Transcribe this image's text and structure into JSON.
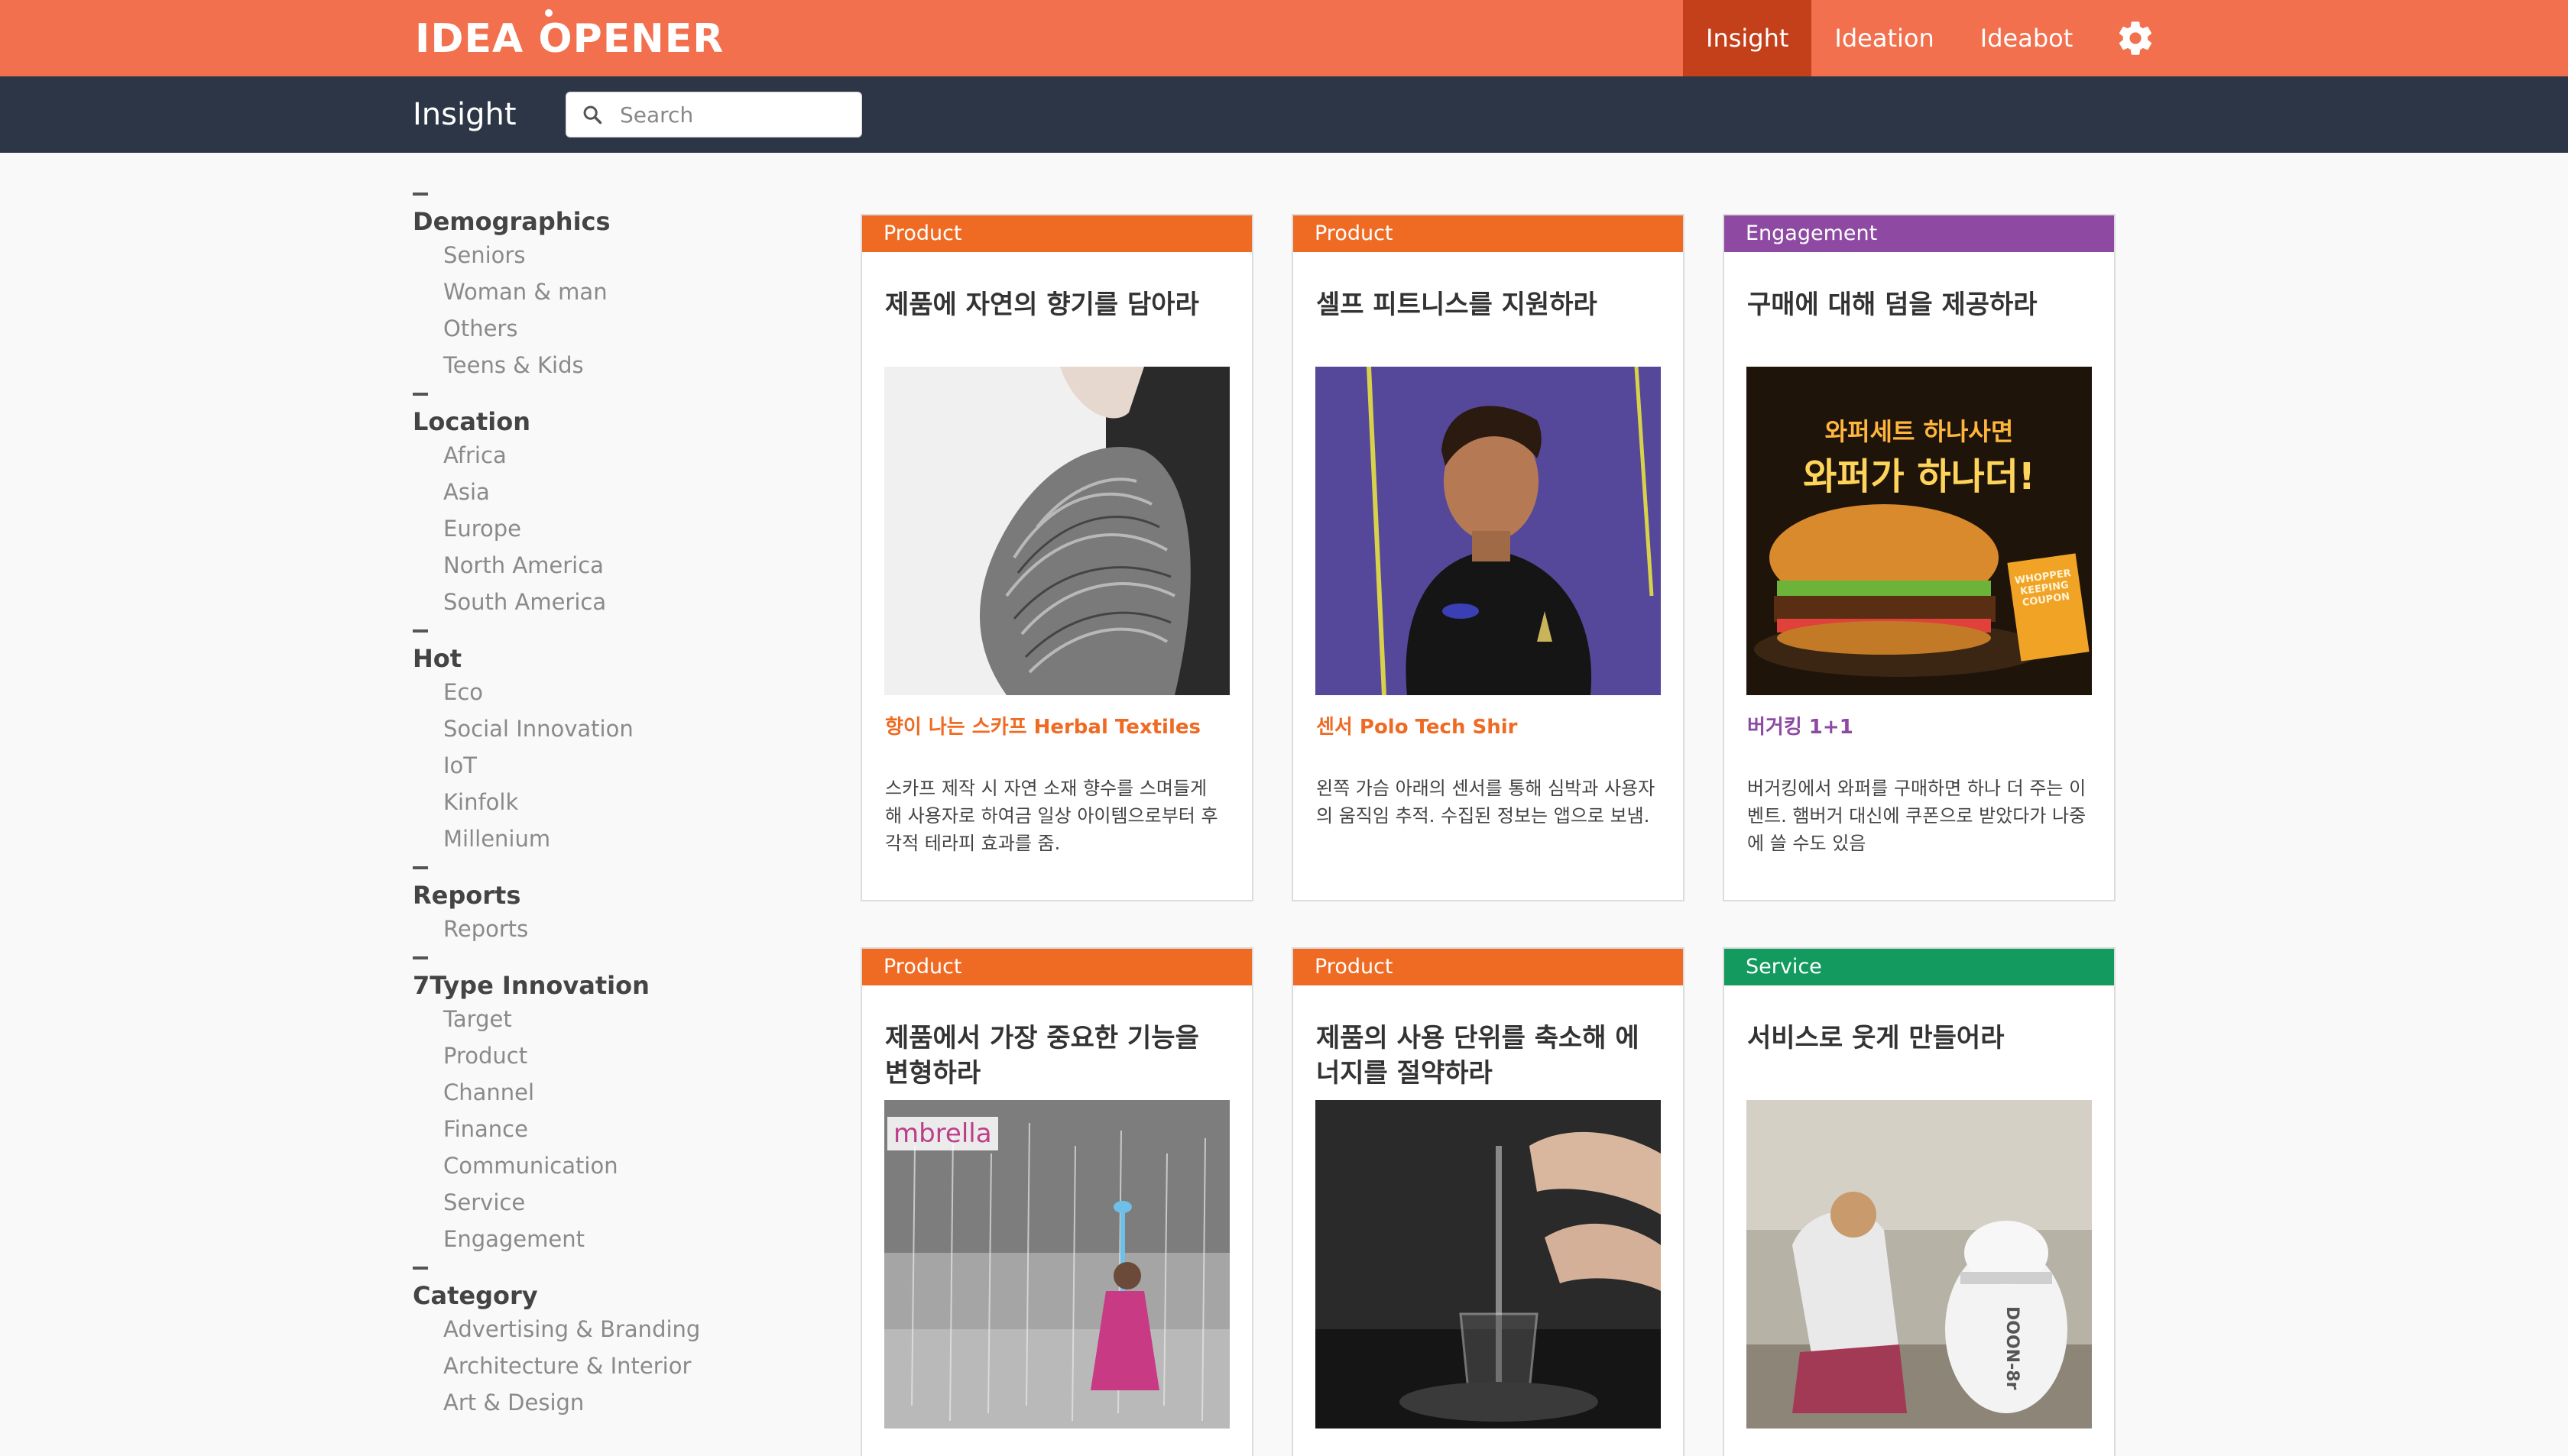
{
  "header": {
    "logo": "IDEA OPENER",
    "nav": [
      {
        "label": "Insight",
        "active": true
      },
      {
        "label": "Ideation",
        "active": false
      },
      {
        "label": "Ideabot",
        "active": false
      }
    ],
    "settings_icon": "gear-icon"
  },
  "subheader": {
    "title": "Insight",
    "search_placeholder": "Search",
    "search_value": ""
  },
  "sidebar": {
    "groups": [
      {
        "heading": "Demographics",
        "items": [
          "Seniors",
          "Woman & man",
          "Others",
          "Teens & Kids"
        ]
      },
      {
        "heading": "Location",
        "items": [
          "Africa",
          "Asia",
          "Europe",
          "North America",
          "South America"
        ]
      },
      {
        "heading": "Hot",
        "items": [
          "Eco",
          "Social Innovation",
          "IoT",
          "Kinfolk",
          "Millenium"
        ]
      },
      {
        "heading": "Reports",
        "items": [
          "Reports"
        ]
      },
      {
        "heading": "7Type Innovation",
        "items": [
          "Target",
          "Product",
          "Channel",
          "Finance",
          "Communication",
          "Service",
          "Engagement"
        ]
      },
      {
        "heading": "Category",
        "items": [
          "Advertising & Branding",
          "Architecture & Interior",
          "Art & Design"
        ]
      }
    ]
  },
  "colors": {
    "brand": "#f2704d",
    "nav_active": "#c4401b",
    "subbar": "#2d3647",
    "product": "#ef6b24",
    "engagement": "#8e4aa3",
    "service": "#129a5f"
  },
  "cards": [
    {
      "tag": "Product",
      "tag_color": "#ef6b24",
      "title": "제품에 자연의 향기를 담아라",
      "subtitle": "향이 나는 스카프 Herbal Textiles",
      "subtitle_color": "#ef6b24",
      "description": "스카프 제작 시 자연 소재 향수를 스며들게 해 사용자로 하여금 일상 아이템으로부터 후각적 테라피 효과를 줌.",
      "image": "scarf-photo"
    },
    {
      "tag": "Product",
      "tag_color": "#ef6b24",
      "title": "셀프 피트니스를 지원하라",
      "subtitle": "센서 Polo Tech Shir",
      "subtitle_color": "#ef6b24",
      "description": "왼쪽 가슴 아래의 센서를 통해 심박과 사용자의 움직임 추적. 수집된 정보는 앱으로 보냄.",
      "image": "tennis-player-photo"
    },
    {
      "tag": "Engagement",
      "tag_color": "#8e4aa3",
      "title": "구매에 대해 덤을 제공하라",
      "subtitle": "버거킹 1+1",
      "subtitle_color": "#8e4aa3",
      "description": "버거킹에서 와퍼를 구매하면 하나 더 주는 이벤트. 햄버거 대신에 쿠폰으로 받았다가 나중에 쓸 수도 있음",
      "image": "burger-ad",
      "image_text": [
        "와퍼세트 하나사면",
        "와퍼가 하나더!"
      ],
      "coupon_text": [
        "WHOPPER",
        "KEEPING",
        "COUPON"
      ]
    },
    {
      "tag": "Product",
      "tag_color": "#ef6b24",
      "title": "제품에서 가장 중요한 기능을 변형하라",
      "subtitle": "",
      "subtitle_color": "#ef6b24",
      "description": "",
      "image": "umbrella-rain-photo",
      "image_text": [
        "mbrella"
      ]
    },
    {
      "tag": "Product",
      "tag_color": "#ef6b24",
      "title": "제품의 사용 단위를 축소해 에너지를 절약하라",
      "subtitle": "",
      "subtitle_color": "#ef6b24",
      "description": "",
      "image": "water-heater-photo"
    },
    {
      "tag": "Service",
      "tag_color": "#129a5f",
      "title": "서비스로 웃게 만들어라",
      "subtitle": "",
      "subtitle_color": "#129a5f",
      "description": "",
      "image": "robot-photo",
      "image_text": [
        "DOON-8r"
      ]
    }
  ]
}
